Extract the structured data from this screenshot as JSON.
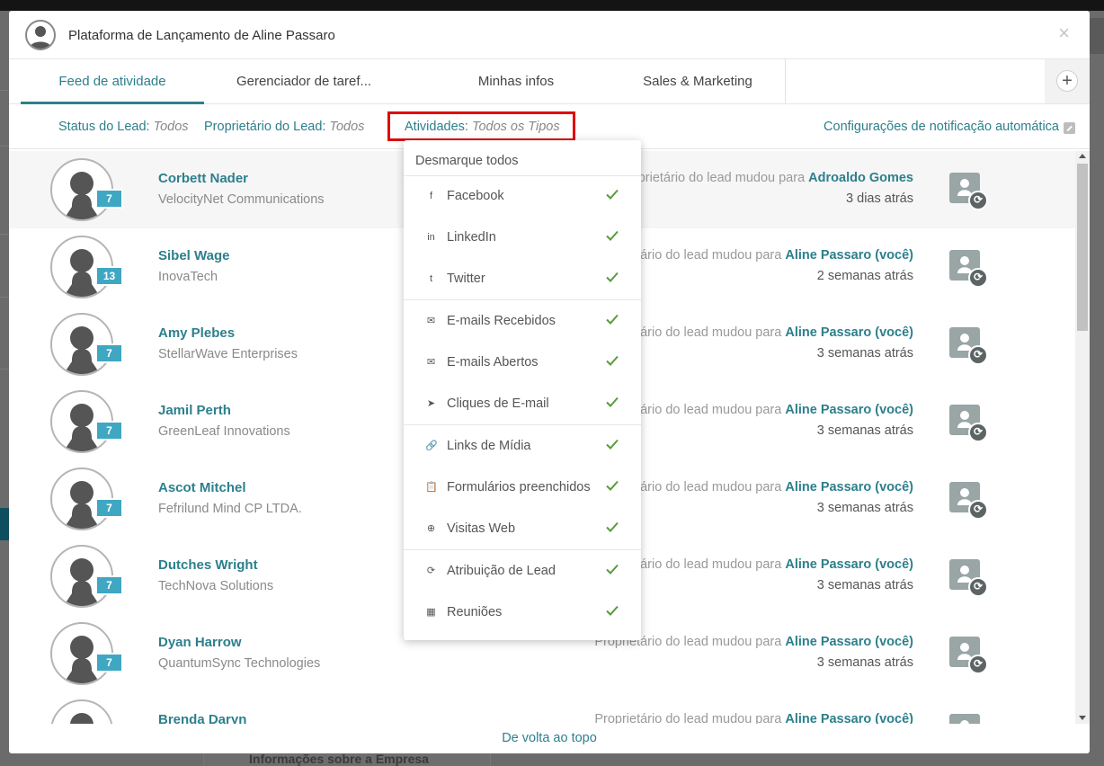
{
  "background": {
    "card_title": "Informações sobre a Empresa"
  },
  "modal": {
    "title": "Plataforma de Lançamento de Aline Passaro",
    "close_label": "×"
  },
  "tabs": [
    {
      "label": "Feed de atividade",
      "active": true
    },
    {
      "label": "Gerenciador de taref...",
      "active": false
    },
    {
      "label": "Minhas infos",
      "active": false
    },
    {
      "label": "Sales & Marketing",
      "active": false
    }
  ],
  "add_tab_label": "+",
  "filters": {
    "status": {
      "label": "Status do Lead:",
      "value": "Todos"
    },
    "owner": {
      "label": "Proprietário do Lead:",
      "value": "Todos"
    },
    "activities": {
      "label": "Atividades:",
      "value": "Todos os Tipos"
    },
    "notifications_link": "Configurações de notificação automática"
  },
  "feed": [
    {
      "name": "Corbett Nader",
      "company": "VelocityNet Communications",
      "badge": "7",
      "event_prefix": "Proprietário do lead mudou para",
      "event_target": "Adroaldo Gomes",
      "when": "3 dias atrás"
    },
    {
      "name": "Sibel Wage",
      "company": "InovaTech",
      "badge": "13",
      "event_prefix": "Proprietário do lead mudou para",
      "event_target": "Aline Passaro (você)",
      "when": "2 semanas atrás"
    },
    {
      "name": "Amy Plebes",
      "company": "StellarWave Enterprises",
      "badge": "7",
      "event_prefix": "Proprietário do lead mudou para",
      "event_target": "Aline Passaro (você)",
      "when": "3 semanas atrás"
    },
    {
      "name": "Jamil Perth",
      "company": "GreenLeaf Innovations",
      "badge": "7",
      "event_prefix": "Proprietário do lead mudou para",
      "event_target": "Aline Passaro (você)",
      "when": "3 semanas atrás"
    },
    {
      "name": "Ascot Mitchel",
      "company": "Fefrilund Mind CP LTDA.",
      "badge": "7",
      "event_prefix": "Proprietário do lead mudou para",
      "event_target": "Aline Passaro (você)",
      "when": "3 semanas atrás"
    },
    {
      "name": "Dutches Wright",
      "company": "TechNova Solutions",
      "badge": "7",
      "event_prefix": "Proprietário do lead mudou para",
      "event_target": "Aline Passaro (você)",
      "when": "3 semanas atrás"
    },
    {
      "name": "Dyan Harrow",
      "company": "QuantumSync Technologies",
      "badge": "7",
      "event_prefix": "Proprietário do lead mudou para",
      "event_target": "Aline Passaro (você)",
      "when": "3 semanas atrás"
    },
    {
      "name": "Brenda Daryn",
      "company": "",
      "badge": "",
      "event_prefix": "Proprietário do lead mudou para",
      "event_target": "Aline Passaro (você)",
      "when": ""
    }
  ],
  "back_to_top": "De volta ao topo",
  "dropdown": {
    "deselect_all": "Desmarque todos",
    "items": [
      {
        "label": "Facebook",
        "icon": "facebook-icon",
        "glyph": "f",
        "checked": true
      },
      {
        "label": "LinkedIn",
        "icon": "linkedin-icon",
        "glyph": "in",
        "checked": true
      },
      {
        "label": "Twitter",
        "icon": "twitter-icon",
        "glyph": "t",
        "checked": true
      },
      {
        "label": "E-mails Recebidos",
        "icon": "envelope-icon",
        "glyph": "✉",
        "checked": true
      },
      {
        "label": "E-mails Abertos",
        "icon": "envelope-open-icon",
        "glyph": "✉",
        "checked": true
      },
      {
        "label": "Cliques de E-mail",
        "icon": "pointer-icon",
        "glyph": "➤",
        "checked": true
      },
      {
        "label": "Links de Mídia",
        "icon": "link-icon",
        "glyph": "🔗",
        "checked": true
      },
      {
        "label": "Formulários preenchidos",
        "icon": "clipboard-icon",
        "glyph": "📋",
        "checked": true
      },
      {
        "label": "Visitas Web",
        "icon": "globe-icon",
        "glyph": "⊕",
        "checked": true
      },
      {
        "label": "Atribuição de Lead",
        "icon": "refresh-icon",
        "glyph": "⟳",
        "checked": true
      },
      {
        "label": "Reuniões",
        "icon": "calendar-icon",
        "glyph": "▦",
        "checked": true
      }
    ]
  },
  "colors": {
    "accent": "#2d7f8c",
    "badge": "#3fa7c2",
    "check": "#5a9a3c",
    "highlight": "#e00000"
  }
}
